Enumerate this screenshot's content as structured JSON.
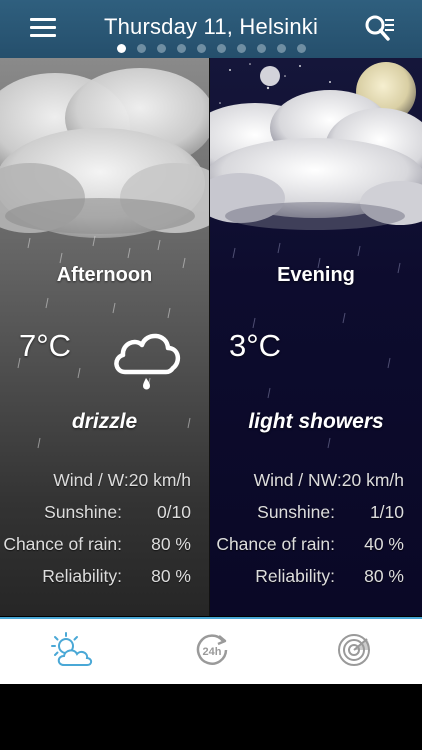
{
  "header": {
    "title": "Thursday 11, Helsinki",
    "page_count": 10,
    "active_page": 0,
    "menu_icon": "menu-icon",
    "search_icon": "search-list-icon"
  },
  "panels": [
    {
      "period": "Afternoon",
      "temperature": "7°C",
      "condition": "drizzle",
      "weather_icon": "drizzle-cloud-icon",
      "wind": "Wind / W:20 km/h",
      "sunshine_label": "Sunshine:",
      "sunshine_value": "0/10",
      "rain_label": "Chance of rain:",
      "rain_value": "80 %",
      "reliability_label": "Reliability:",
      "reliability_value": "80 %"
    },
    {
      "period": "Evening",
      "temperature": "3°C",
      "condition": "light showers",
      "wind": "Wind / NW:20 km/h",
      "sunshine_label": "Sunshine:",
      "sunshine_value": "1/10",
      "rain_label": "Chance of rain:",
      "rain_value": "40 %",
      "reliability_label": "Reliability:",
      "reliability_value": "80 %"
    }
  ],
  "tabbar": {
    "tabs": [
      {
        "icon": "sun-cloud-icon",
        "active": true
      },
      {
        "icon": "24h-forecast-icon",
        "active": false
      },
      {
        "icon": "radar-icon",
        "active": false
      }
    ],
    "active_color": "#4aa8d6",
    "inactive_color": "#9a9a9a"
  }
}
